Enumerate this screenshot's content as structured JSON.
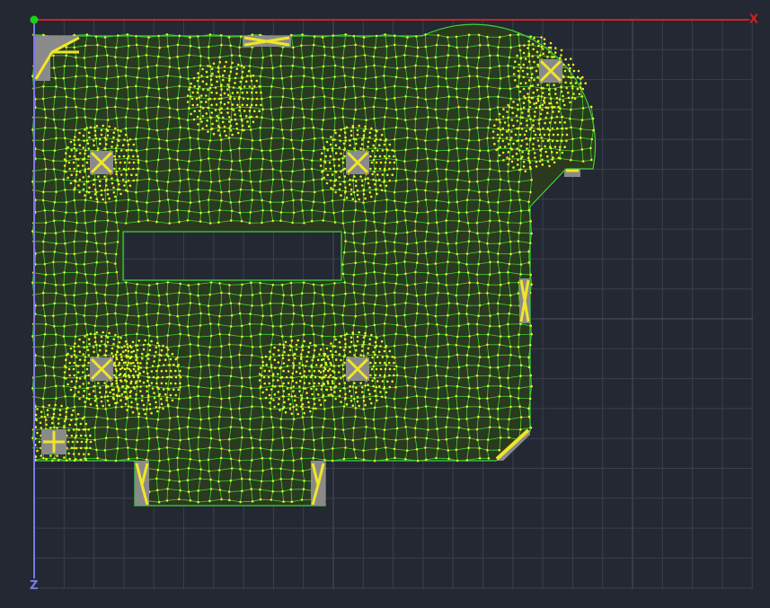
{
  "viewport": {
    "title": "",
    "background": "#232832",
    "grid": true,
    "grid_color": "#3a404c",
    "grid_major_color": "#4a5160"
  },
  "axes": {
    "x": {
      "label": "X",
      "color": "#d42020"
    },
    "z": {
      "label": "Z",
      "color": "#7a7ae8"
    },
    "origin_color": "#19d119"
  },
  "mesh": {
    "slab_color": "#2b3a1f",
    "line_color": "#3ad43a",
    "node_color": "#e8f020",
    "support_fill": "#8a8a8a",
    "support_mark_color": "#f0e628"
  }
}
